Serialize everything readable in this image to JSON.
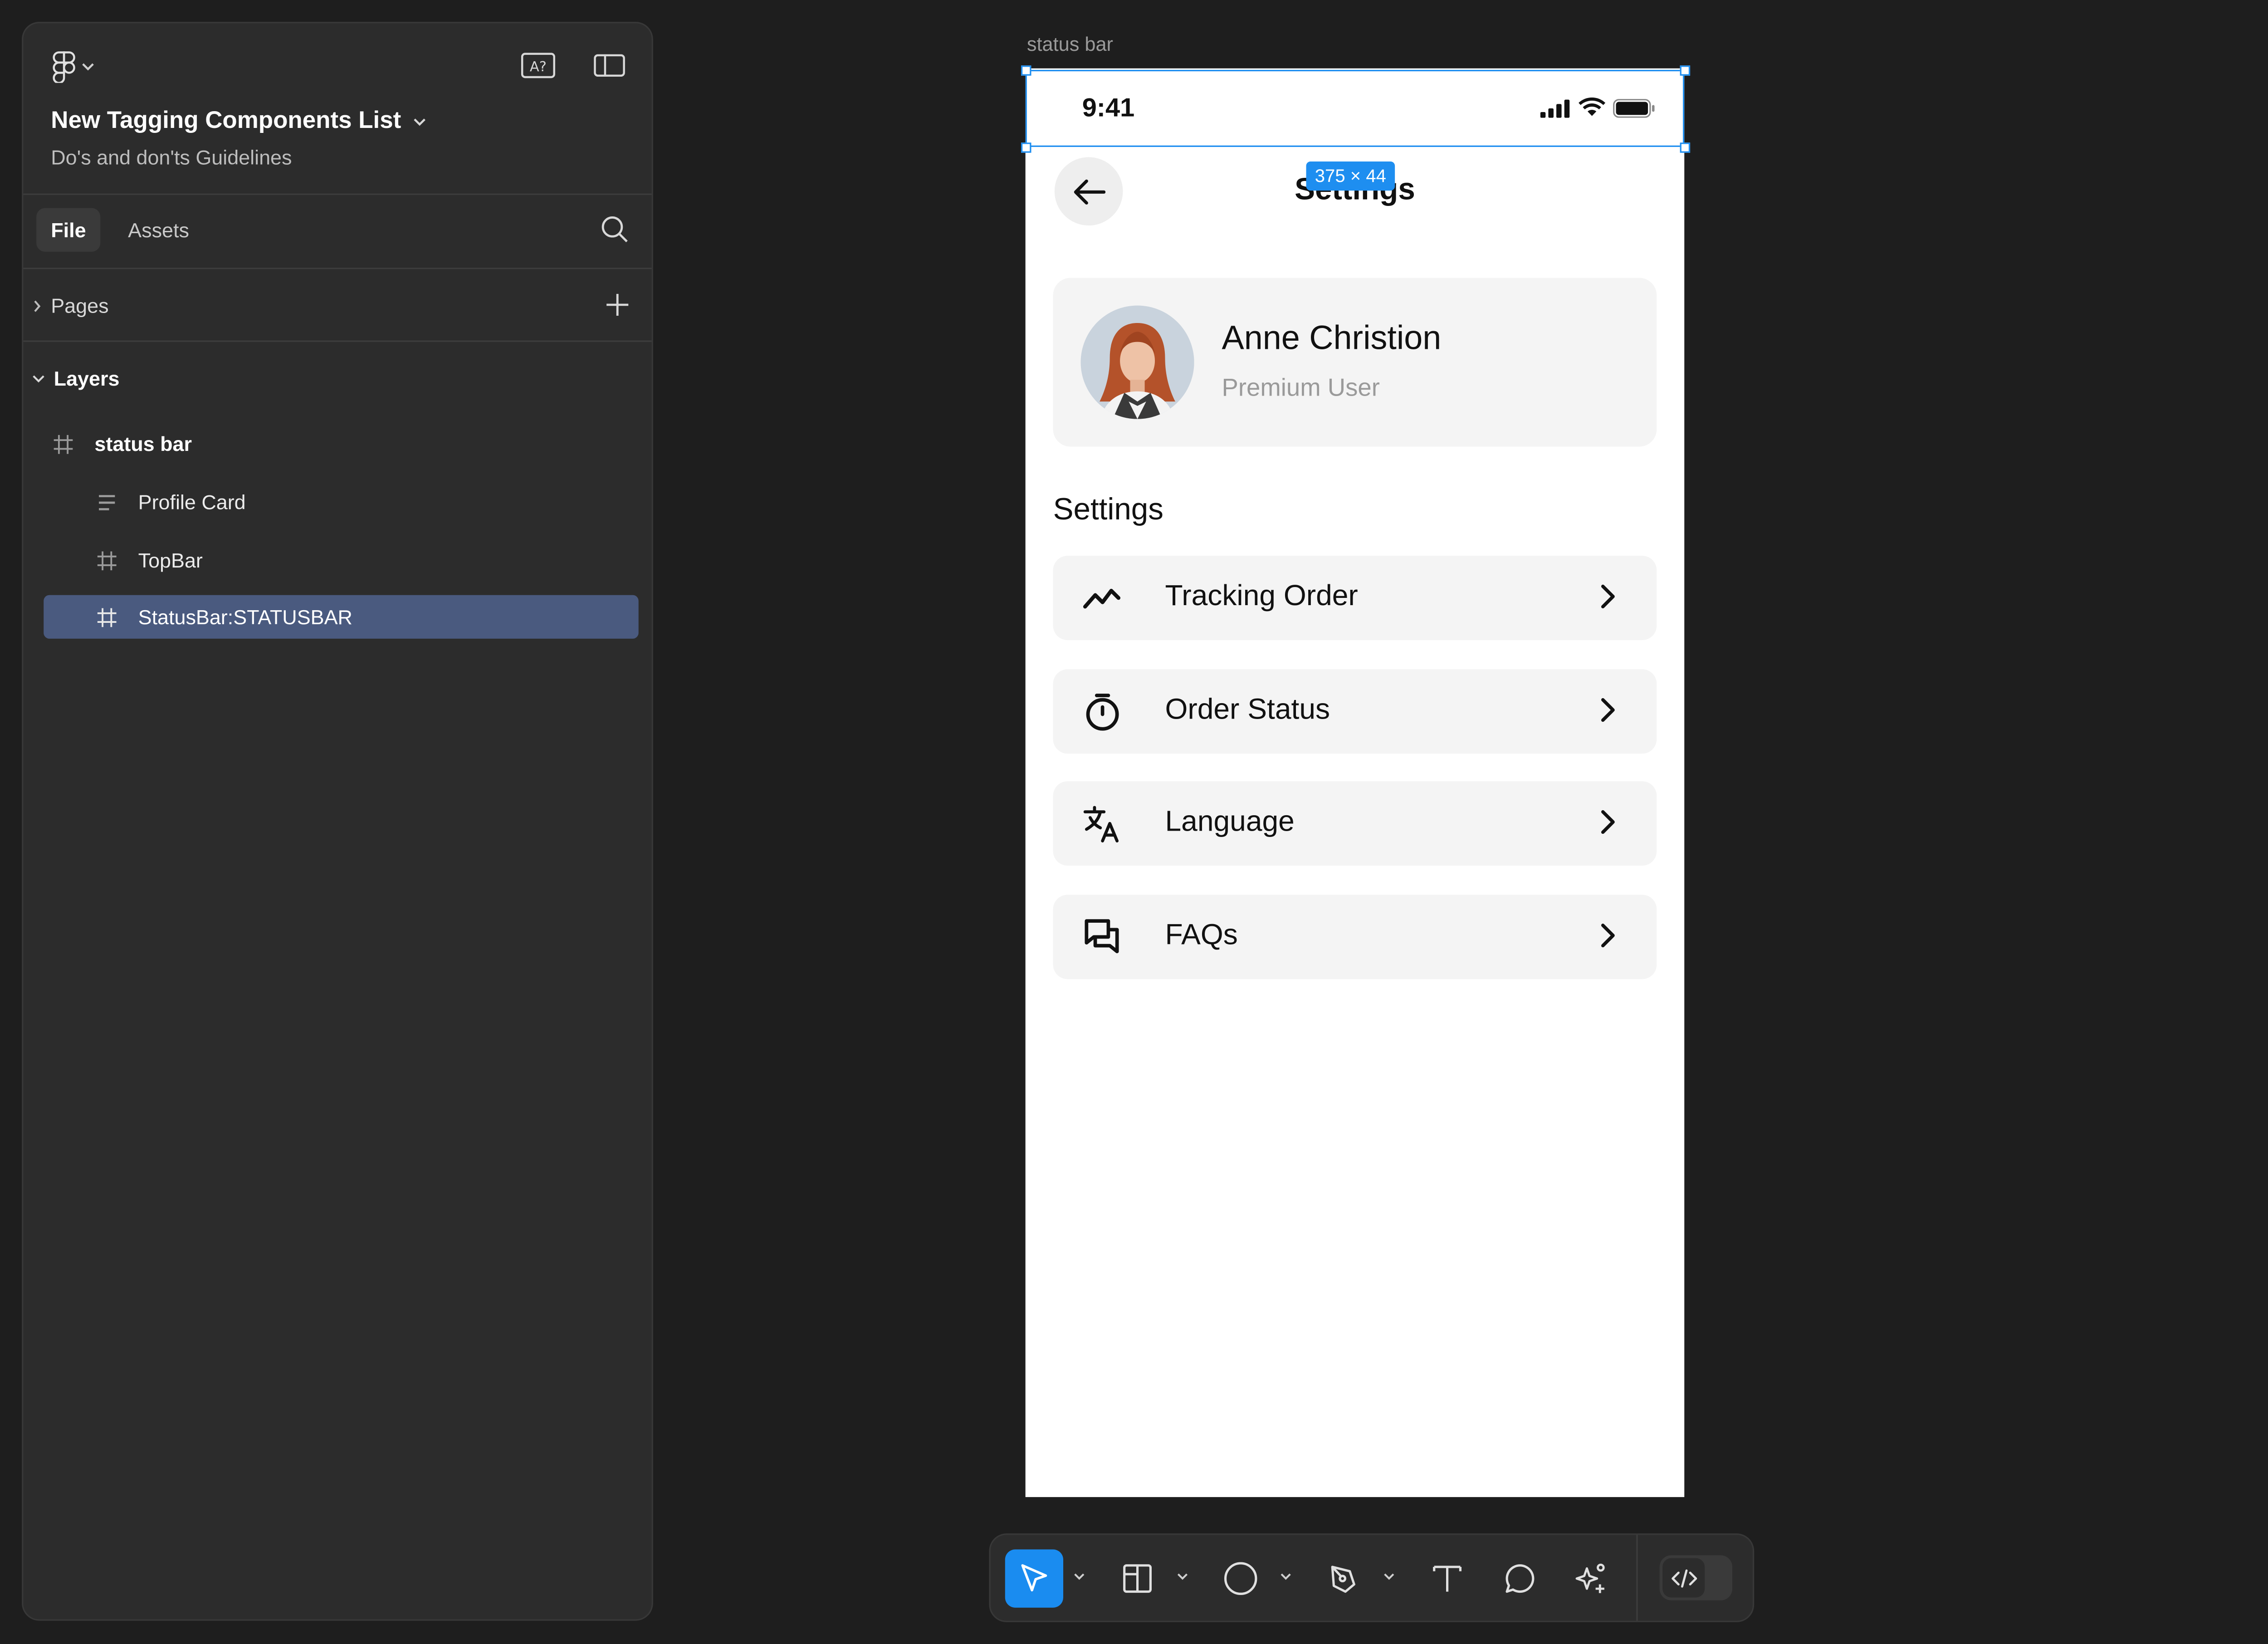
{
  "file": {
    "title": "New Tagging Components List",
    "subtitle": "Do's and don'ts Guidelines"
  },
  "tabs": {
    "file": "File",
    "assets": "Assets"
  },
  "sections": {
    "pages": "Pages",
    "layers": "Layers"
  },
  "layers": [
    {
      "name": "status bar",
      "icon": "frame-icon"
    },
    {
      "name": "Profile Card",
      "icon": "text-align-icon"
    },
    {
      "name": "TopBar",
      "icon": "frame-icon"
    },
    {
      "name": "StatusBar:STATUSBAR",
      "icon": "frame-icon",
      "selected": true
    }
  ],
  "canvas": {
    "frame_label": "status bar",
    "selection_size": "375 × 44"
  },
  "phone": {
    "time": "9:41",
    "title": "Settings",
    "profile": {
      "name": "Anne Christion",
      "role": "Premium User"
    },
    "section_title": "Settings",
    "menu": [
      {
        "label": "Tracking Order",
        "icon": "trending-icon"
      },
      {
        "label": "Order Status",
        "icon": "timer-icon"
      },
      {
        "label": "Language",
        "icon": "translate-icon"
      },
      {
        "label": "FAQs",
        "icon": "chat-bubbles-icon"
      }
    ]
  },
  "toolbar": {
    "tools": [
      "move-tool",
      "frame-tool",
      "ellipse-tool",
      "pen-tool",
      "text-tool",
      "comment-tool",
      "ai-tool"
    ],
    "active": "move-tool"
  },
  "colors": {
    "accent": "#1e8ef0",
    "panel": "#2c2c2c",
    "canvas": "#1e1e1e",
    "selected_layer": "#4a5a7f",
    "card": "#f4f4f4"
  }
}
